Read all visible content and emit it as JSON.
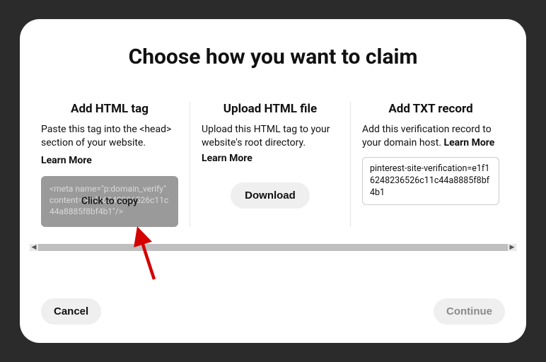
{
  "title": "Choose how you want to claim",
  "columns": {
    "html_tag": {
      "heading": "Add HTML tag",
      "desc": "Paste this tag into the <head> section of your website.",
      "learn": "Learn More",
      "code": "<meta name=\"p:domain_verify\" content=\"e1f16248236526c11c44a8885f8bf4b1\"/>",
      "copy_label": "Click to copy"
    },
    "upload": {
      "heading": "Upload HTML file",
      "desc": "Upload this HTML tag to your website's root directory.",
      "learn": "Learn More",
      "download_label": "Download"
    },
    "txt": {
      "heading": "Add TXT record",
      "desc": "Add this verification record to your domain host.",
      "learn": "Learn More",
      "record": "pinterest-site-verification=e1f16248236526c11c44a8885f8bf4b1"
    }
  },
  "buttons": {
    "cancel": "Cancel",
    "continue": "Continue"
  }
}
